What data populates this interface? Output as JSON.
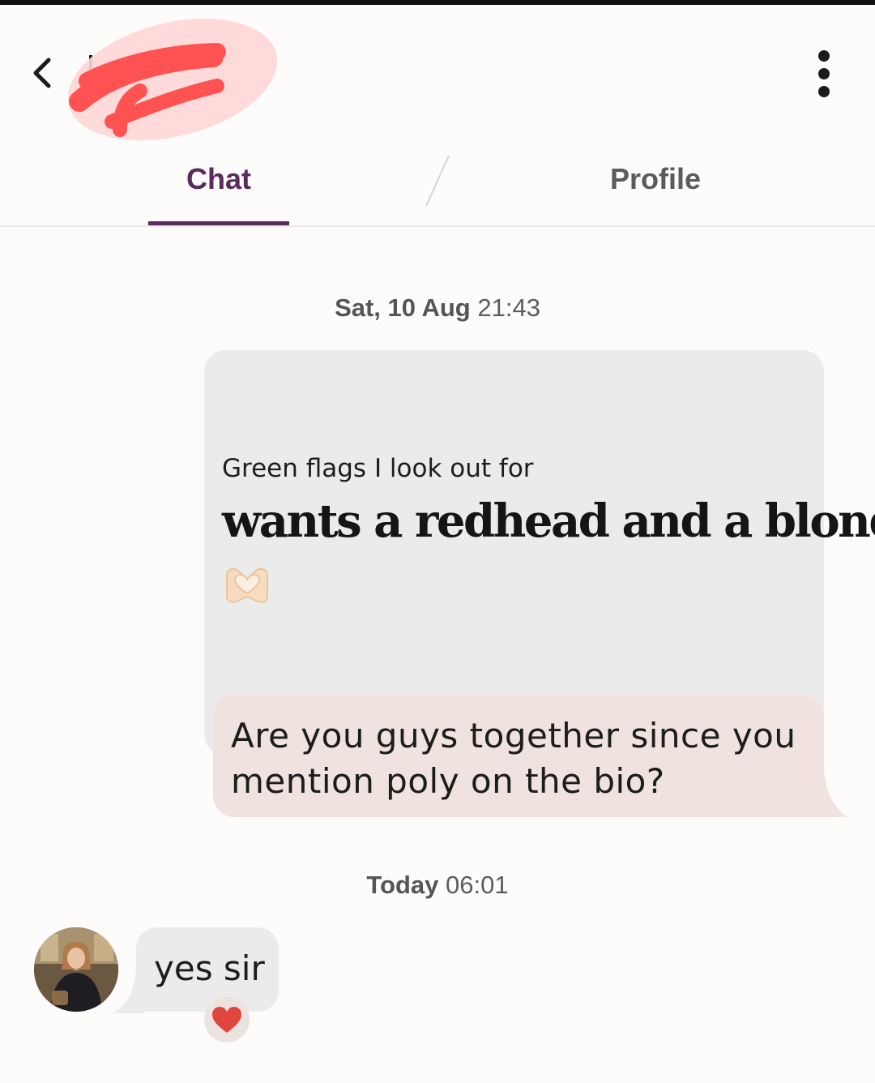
{
  "header": {
    "back_icon": "chevron-left-icon",
    "more_icon": "more-vertical-icon",
    "redacted_name": "redacted"
  },
  "tabs": [
    {
      "label": "Chat",
      "active": true
    },
    {
      "label": "Profile",
      "active": false
    }
  ],
  "colors": {
    "accent": "#5b2a5f",
    "outgoing_bubble": "#efe2df",
    "incoming_bubble": "#ecebeb",
    "redaction": "#ff5252",
    "heart": "#e0453e"
  },
  "conversation": {
    "timestamp1": {
      "day": "Sat, 10 Aug",
      "time": "21:43"
    },
    "prompt": {
      "question": "Green flags I look out for",
      "answer": "wants a redhead and a blond",
      "emoji_icon": "heart-hands-icon"
    },
    "outgoing_message": "Are you guys together since you mention poly on the bio?",
    "timestamp2": {
      "day": "Today",
      "time": "06:01"
    },
    "incoming_message": "yes sir",
    "reaction_icon": "heart-icon"
  }
}
